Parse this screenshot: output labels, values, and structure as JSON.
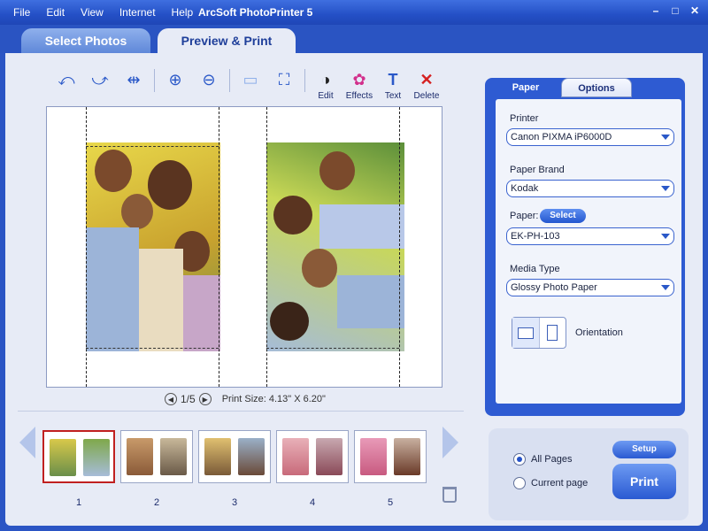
{
  "menu": [
    "File",
    "Edit",
    "View",
    "Internet",
    "Help"
  ],
  "app_title": "ArcSoft PhotoPrinter 5",
  "tabs": {
    "select_photos": "Select Photos",
    "preview_print": "Preview & Print"
  },
  "toolbar": {
    "edit": "Edit",
    "effects": "Effects",
    "text": "Text",
    "delete": "Delete"
  },
  "pager": {
    "current": "1/5",
    "print_size": "Print Size: 4.13\" X 6.20\""
  },
  "thumbnails": {
    "numbers": [
      "1",
      "2",
      "3",
      "4",
      "5"
    ],
    "selected": 1
  },
  "paper_panel": {
    "tab_paper": "Paper",
    "tab_options": "Options",
    "printer_label": "Printer",
    "printer_value": "Canon PIXMA iP6000D",
    "brand_label": "Paper Brand",
    "brand_value": "Kodak",
    "paper_label": "Paper:",
    "select_button": "Select",
    "paper_value": "EK-PH-103",
    "media_label": "Media Type",
    "media_value": "Glossy Photo Paper",
    "orientation_label": "Orientation"
  },
  "print_box": {
    "all_pages": "All Pages",
    "current_page": "Current page",
    "setup": "Setup",
    "print": "Print"
  },
  "colors": {
    "accent": "#2e5bd2",
    "selection": "#c02020"
  }
}
